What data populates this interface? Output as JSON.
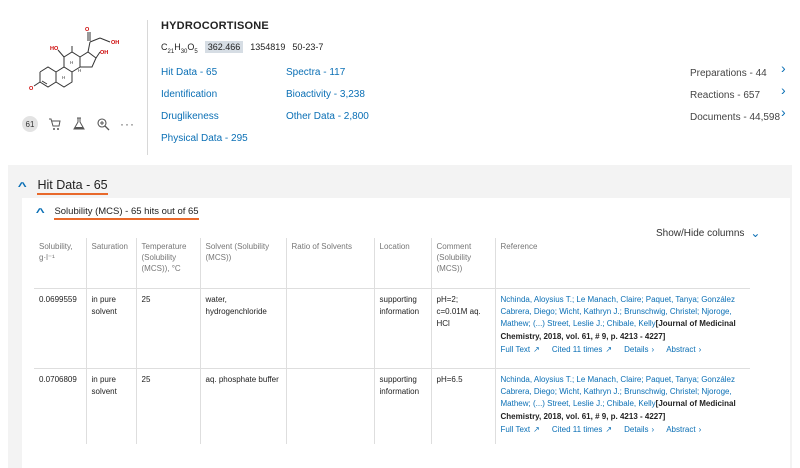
{
  "compound": {
    "name": "HYDROCORTISONE",
    "formula_main": "C",
    "formula_c_count": "21",
    "formula_h": "H",
    "formula_h_count": "30",
    "formula_o": "O",
    "formula_o_count": "5",
    "mol_weight": "362.466",
    "reaxys_id": "1354819",
    "cas": "50-23-7",
    "atom_labels": [
      "OH",
      "HO",
      "O",
      "OH",
      "H",
      "H",
      "H",
      "O"
    ]
  },
  "mol_tools": {
    "count_badge": "61",
    "icons": [
      "cart-icon",
      "flask-icon",
      "zoom-icon",
      "more-icon"
    ],
    "more_label": "···"
  },
  "links_left": [
    "Hit Data - 65",
    "Identification",
    "Druglikeness",
    "Physical Data - 295"
  ],
  "links_mid": [
    "Spectra - 117",
    "Bioactivity - 3,238",
    "Other Data - 2,800"
  ],
  "right_links": [
    {
      "label": "Preparations - 44"
    },
    {
      "label": "Reactions - 657"
    },
    {
      "label": "Documents - 44,598"
    }
  ],
  "section": {
    "title": "Hit Data - 65"
  },
  "subsection": {
    "title": "Solubility (MCS) - 65 hits out of 65"
  },
  "show_hide": "Show/Hide columns",
  "columns": [
    "Solubility, g·l⁻¹",
    "Saturation",
    "Temperature (Solubility (MCS)), °C",
    "Solvent (Solubility (MCS))",
    "Ratio of Solvents",
    "Location",
    "Comment (Solubility (MCS))",
    "Reference"
  ],
  "rows": [
    {
      "solubility": "0.0699559",
      "saturation": "in pure solvent",
      "temperature": "25",
      "solvent": "water, hydrogenchloride",
      "ratio": "",
      "location": "supporting information",
      "comment": "pH=2; c=0.01M aq. HCl",
      "ref_authors": "Nchinda, Aloysius T.; Le Manach, Claire; Paquet, Tanya; González Cabrera, Diego; Wicht, Kathryn J.; Brunschwig, Christel; Njoroge, Mathew; (...) Street, Leslie J.; Chibale, Kelly",
      "ref_journal": "[Journal of Medicinal Chemistry, 2018, vol. 61, # 9, p. 4213 - 4227]",
      "full_text": "Full Text",
      "cited": "Cited 11 times",
      "details": "Details",
      "abstract": "Abstract"
    },
    {
      "solubility": "0.0706809",
      "saturation": "in pure solvent",
      "temperature": "25",
      "solvent": "aq. phosphate buffer",
      "ratio": "",
      "location": "supporting information",
      "comment": "pH=6.5",
      "ref_authors": "Nchinda, Aloysius T.; Le Manach, Claire; Paquet, Tanya; González Cabrera, Diego; Wicht, Kathryn J.; Brunschwig, Christel; Njoroge, Mathew; (...) Street, Leslie J.; Chibale, Kelly",
      "ref_journal": "[Journal of Medicinal Chemistry, 2018, vol. 61, # 9, p. 4213 - 4227]",
      "full_text": "Full Text",
      "cited": "Cited 11 times",
      "details": "Details",
      "abstract": "Abstract"
    }
  ],
  "colors": {
    "link": "#0a6fb5",
    "accent_underline": "#e8692b",
    "atom_red": "#cc0000",
    "section_bg": "#f3f3f3"
  }
}
